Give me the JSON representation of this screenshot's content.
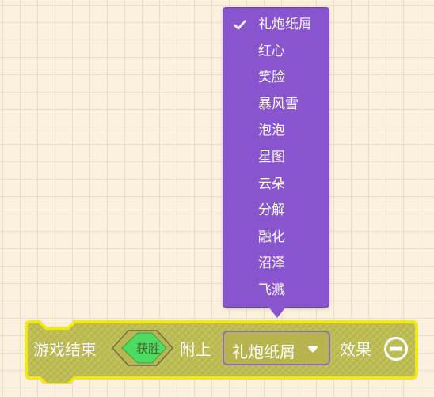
{
  "dropdown": {
    "selected_index": 0,
    "items": [
      {
        "label": "礼炮纸屑"
      },
      {
        "label": "红心"
      },
      {
        "label": "笑脸"
      },
      {
        "label": "暴风雪"
      },
      {
        "label": "泡泡"
      },
      {
        "label": "星图"
      },
      {
        "label": "云朵"
      },
      {
        "label": "分解"
      },
      {
        "label": "融化"
      },
      {
        "label": "沼泽"
      },
      {
        "label": "飞溅"
      }
    ]
  },
  "block": {
    "prefix_label": "游戏结束",
    "condition_value": "获胜",
    "attach_label": "附上",
    "effect_value": "礼炮纸屑",
    "suffix_label": "效果",
    "remove_icon": "minus-circle-icon"
  },
  "colors": {
    "menu_bg": "#8855cf",
    "block_fill": "#b9b84f",
    "block_outline": "#f2ea12",
    "condition_green": "#4ddc61",
    "workspace_bg": "#fbf1df"
  }
}
